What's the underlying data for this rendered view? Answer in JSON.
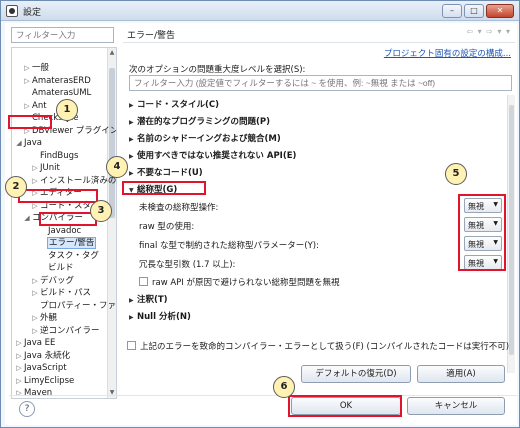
{
  "window": {
    "title": "設定",
    "controls": [
      "–",
      "□",
      "✕"
    ]
  },
  "left": {
    "filter_placeholder": "フィルター入力",
    "tree": [
      {
        "label": "一般",
        "arrow": "▷"
      },
      {
        "label": "AmaterasERD",
        "arrow": "▷"
      },
      {
        "label": "AmaterasUML",
        "arrow": ""
      },
      {
        "label": "Ant",
        "arrow": "▷"
      },
      {
        "label": "Checkstyle",
        "arrow": ""
      },
      {
        "label": "DBViewer プラグイン",
        "arrow": "▷"
      },
      {
        "label": "Java",
        "arrow": "◢"
      },
      {
        "label": "FindBugs",
        "arrow": ""
      },
      {
        "label": "JUnit",
        "arrow": "▷"
      },
      {
        "label": "インストール済みの",
        "arrow": "▷"
      },
      {
        "label": "エディター",
        "arrow": "▷"
      },
      {
        "label": "コード・スタイル",
        "arrow": "▷"
      },
      {
        "label": "コンパイラー",
        "arrow": "◢"
      },
      {
        "label": "Javadoc",
        "arrow": ""
      },
      {
        "label": "エラー/警告",
        "arrow": ""
      },
      {
        "label": "タスク・タグ",
        "arrow": ""
      },
      {
        "label": "ビルド",
        "arrow": ""
      },
      {
        "label": "デバッグ",
        "arrow": "▷"
      },
      {
        "label": "ビルド・パス",
        "arrow": "▷"
      },
      {
        "label": "プロパティー・ファ",
        "arrow": ""
      },
      {
        "label": "外観",
        "arrow": "▷"
      },
      {
        "label": "逆コンパイラー",
        "arrow": "▷"
      },
      {
        "label": "Java EE",
        "arrow": "▷"
      },
      {
        "label": "Java 永続化",
        "arrow": "▷"
      },
      {
        "label": "JavaScript",
        "arrow": "▷"
      },
      {
        "label": "LimyEclipse",
        "arrow": "▷"
      },
      {
        "label": "Maven",
        "arrow": "▷"
      }
    ]
  },
  "right": {
    "title": "エラー/警告",
    "nav": "⇦ ▾ ⇨ ▾ ▾",
    "project_link": "プロジェクト固有の設定の構成...",
    "severity_label": "次のオプションの問題重大度レベルを選択(S):",
    "filter_placeholder": "フィルター入力 (設定値でフィルターするには ~ を使用、例: ~無視 または ~off)",
    "sections_top": [
      {
        "label": "コード・スタイル(C)"
      },
      {
        "label": "潜在的なプログラミングの問題(P)"
      },
      {
        "label": "名前のシャドーイングおよび競合(M)"
      },
      {
        "label": "使用すべきではない推奨されない API(E)"
      },
      {
        "label": "不要なコード(U)"
      }
    ],
    "generics": {
      "label": "総称型(G)",
      "options": [
        {
          "label": "未検査の総称型操作:",
          "value": "無視"
        },
        {
          "label": "raw 型の使用:",
          "value": "無視"
        },
        {
          "label": "final な型で制約された総称型パラメーター(Y):",
          "value": "無視"
        },
        {
          "label": "冗長な型引数 (1.7 以上):",
          "value": "無視"
        }
      ],
      "checkbox_label": "raw API が原因で避けられない総称型問題を無視"
    },
    "sections_bottom": [
      {
        "label": "注釈(T)"
      },
      {
        "label": "Null 分析(N)"
      }
    ],
    "fatal_checkbox": "上記のエラーを致命的コンパイラー・エラーとして扱う(F) (コンパイルされたコードは実行不可)",
    "restore_defaults": "デフォルトの復元(D)",
    "apply": "適用(A)",
    "ok": "OK",
    "cancel": "キャンセル"
  },
  "help_icon": "?",
  "annotations": [
    "1",
    "2",
    "3",
    "4",
    "5",
    "6"
  ]
}
